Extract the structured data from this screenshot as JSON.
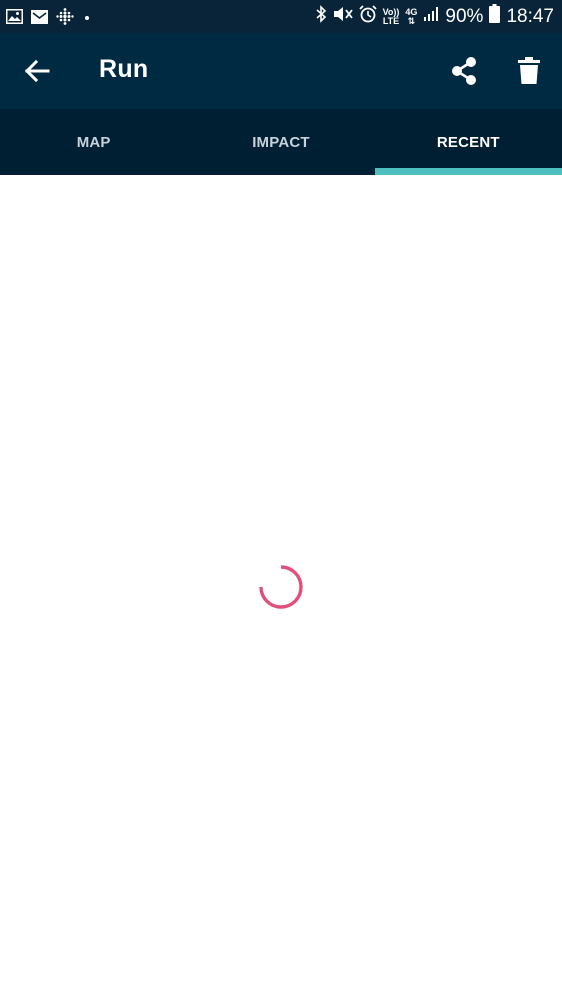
{
  "status_bar": {
    "vol_label": "Vo))",
    "lte_label": "LTE",
    "network_label": "4G",
    "battery_percent": "90%",
    "time": "18:47"
  },
  "app_bar": {
    "title": "Run"
  },
  "tabs": [
    {
      "label": "MAP",
      "active": false
    },
    {
      "label": "IMPACT",
      "active": false
    },
    {
      "label": "RECENT",
      "active": true
    }
  ],
  "colors": {
    "status_bar_bg": "#092438",
    "app_bar_bg": "#002a42",
    "tab_bar_bg": "#001f33",
    "tab_indicator": "#4dbfbf",
    "spinner": "#e0507a"
  },
  "icons": {
    "back": "arrow-left-icon",
    "share": "share-icon",
    "delete": "trash-icon",
    "loading": "loading-spinner-icon"
  }
}
